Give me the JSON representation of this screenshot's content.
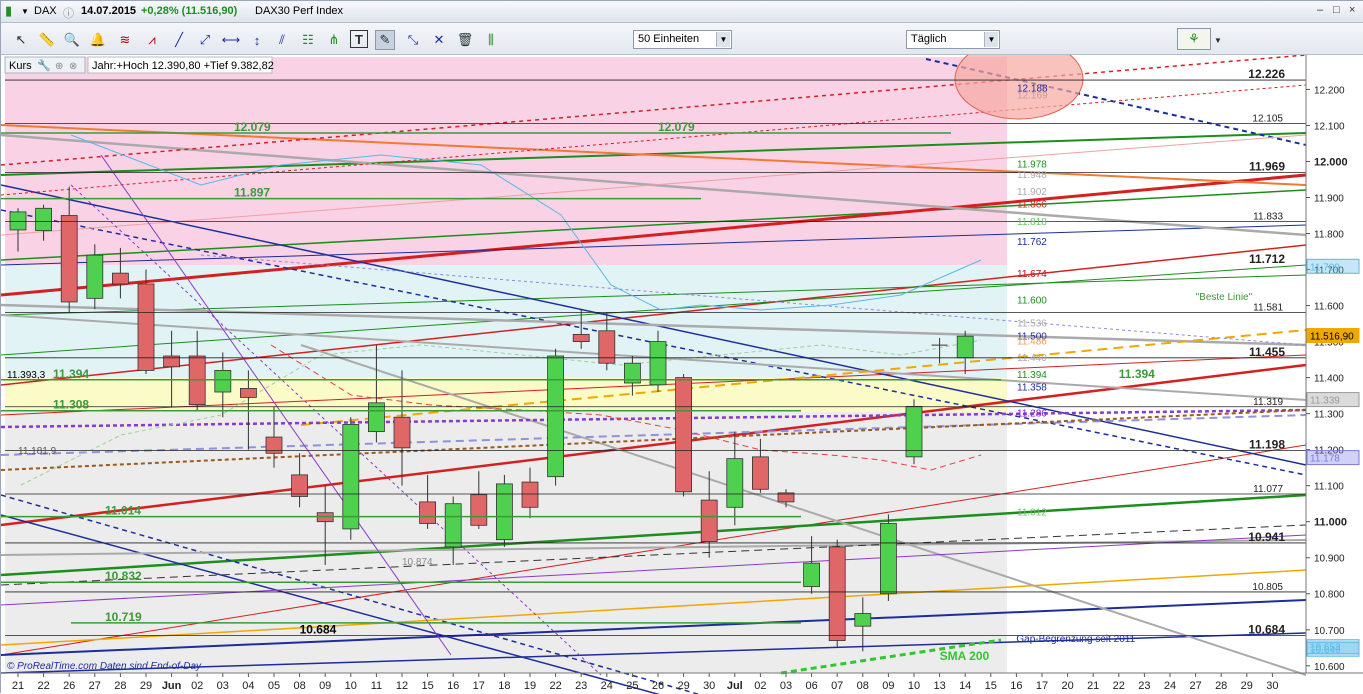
{
  "titlebar": {
    "symbol": "DAX",
    "date": "14.07.2015",
    "change": "+0,28% (11.516,90)",
    "instrument": "DAX30 Perf Index",
    "window_controls": [
      "–",
      "□",
      "×"
    ]
  },
  "toolbar": {
    "units_select": "50 Einheiten",
    "interval_select": "Täglich",
    "tools": [
      "cursor-icon",
      "ruler-icon",
      "zoom-icon",
      "alert-bell-icon",
      "fibonacci-icon",
      "channel-icon",
      "trendline-icon",
      "ray-icon",
      "horizontal-line-icon",
      "vertical-line-icon",
      "parallel-lines-icon",
      "gann-fan-icon",
      "pitchfork-icon",
      "text-icon",
      "drawing-tools-icon",
      "pitchfork-alt-icon",
      "cross-lines-icon",
      "trash-icon",
      "andrews-icon"
    ]
  },
  "chart_header": {
    "label": "Kurs",
    "range_text": "Jahr:+Hoch 12.390,80 +Tief 9.382,82"
  },
  "chart_data": {
    "type": "candlestick",
    "title": "DAX30 Perf Index",
    "ylim": [
      10580,
      12290
    ],
    "x_tick_labels": [
      "21",
      "22",
      "26",
      "27",
      "28",
      "29",
      "Jun",
      "02",
      "03",
      "04",
      "05",
      "08",
      "09",
      "10",
      "11",
      "12",
      "15",
      "16",
      "17",
      "18",
      "19",
      "22",
      "23",
      "24",
      "25",
      "26",
      "29",
      "30",
      "Jul",
      "02",
      "03",
      "06",
      "07",
      "08",
      "09",
      "10",
      "13",
      "14",
      "15",
      "16",
      "17",
      "20",
      "21",
      "22",
      "23",
      "24",
      "27",
      "28",
      "29",
      "30"
    ],
    "y_ticks": [
      10600,
      10700,
      10800,
      10900,
      11000,
      11100,
      11200,
      11300,
      11400,
      11500,
      11600,
      11700,
      11800,
      11900,
      12000,
      12100,
      12200
    ],
    "y_tick_labels": [
      "10.600",
      "10.700",
      "10.800",
      "10.900",
      "11.000",
      "11.100",
      "11.200",
      "11.300",
      "11.400",
      "11.500",
      "11.600",
      "11.700",
      "11.800",
      "11.900",
      "12.000",
      "12.100",
      "12.200"
    ],
    "candles": [
      {
        "date": "21",
        "open": 11810,
        "high": 11870,
        "low": 11750,
        "close": 11860
      },
      {
        "date": "22",
        "open": 11808,
        "high": 11880,
        "low": 11780,
        "close": 11870
      },
      {
        "date": "26",
        "open": 11850,
        "high": 11930,
        "low": 11580,
        "close": 11610
      },
      {
        "date": "27",
        "open": 11620,
        "high": 11770,
        "low": 11590,
        "close": 11740
      },
      {
        "date": "28",
        "open": 11690,
        "high": 11760,
        "low": 11620,
        "close": 11660
      },
      {
        "date": "29",
        "open": 11660,
        "high": 11700,
        "low": 11410,
        "close": 11420
      },
      {
        "date": "Jun",
        "open": 11460,
        "high": 11530,
        "low": 11320,
        "close": 11430
      },
      {
        "date": "02",
        "open": 11460,
        "high": 11530,
        "low": 11310,
        "close": 11325
      },
      {
        "date": "03",
        "open": 11360,
        "high": 11470,
        "low": 11290,
        "close": 11420
      },
      {
        "date": "04",
        "open": 11370,
        "high": 11420,
        "low": 11200,
        "close": 11345
      },
      {
        "date": "05",
        "open": 11235,
        "high": 11320,
        "low": 11150,
        "close": 11190
      },
      {
        "date": "08",
        "open": 11130,
        "high": 11190,
        "low": 11040,
        "close": 11070
      },
      {
        "date": "09",
        "open": 11025,
        "high": 11100,
        "low": 10880,
        "close": 11000
      },
      {
        "date": "10",
        "open": 10980,
        "high": 11290,
        "low": 10950,
        "close": 11270
      },
      {
        "date": "11",
        "open": 11250,
        "high": 11490,
        "low": 11220,
        "close": 11330
      },
      {
        "date": "12",
        "open": 11290,
        "high": 11420,
        "low": 11100,
        "close": 11205
      },
      {
        "date": "15",
        "open": 11055,
        "high": 11130,
        "low": 10980,
        "close": 10995
      },
      {
        "date": "16",
        "open": 10930,
        "high": 11070,
        "low": 10880,
        "close": 11050
      },
      {
        "date": "17",
        "open": 11075,
        "high": 11140,
        "low": 10980,
        "close": 10990
      },
      {
        "date": "18",
        "open": 10950,
        "high": 11130,
        "low": 10930,
        "close": 11105
      },
      {
        "date": "19",
        "open": 11110,
        "high": 11150,
        "low": 11010,
        "close": 11040
      },
      {
        "date": "22",
        "open": 11125,
        "high": 11480,
        "low": 11100,
        "close": 11460
      },
      {
        "date": "23",
        "open": 11520,
        "high": 11590,
        "low": 11480,
        "close": 11500
      },
      {
        "date": "24",
        "open": 11530,
        "high": 11580,
        "low": 11420,
        "close": 11440
      },
      {
        "date": "25",
        "open": 11385,
        "high": 11460,
        "low": 11350,
        "close": 11440
      },
      {
        "date": "26",
        "open": 11380,
        "high": 11530,
        "low": 11360,
        "close": 11500
      },
      {
        "date": "29",
        "open": 11400,
        "high": 11410,
        "low": 11070,
        "close": 11083
      },
      {
        "date": "30",
        "open": 11060,
        "high": 11140,
        "low": 10900,
        "close": 10945
      },
      {
        "date": "Jul",
        "open": 11040,
        "high": 11250,
        "low": 10990,
        "close": 11175
      },
      {
        "date": "02",
        "open": 11180,
        "high": 11230,
        "low": 11080,
        "close": 11090
      },
      {
        "date": "03",
        "open": 11080,
        "high": 11090,
        "low": 11040,
        "close": 11055
      },
      {
        "date": "06",
        "open": 10820,
        "high": 10960,
        "low": 10800,
        "close": 10885
      },
      {
        "date": "07",
        "open": 10930,
        "high": 10950,
        "low": 10650,
        "close": 10670
      },
      {
        "date": "08",
        "open": 10710,
        "high": 10790,
        "low": 10640,
        "close": 10745
      },
      {
        "date": "09",
        "open": 10800,
        "high": 11020,
        "low": 10780,
        "close": 10995
      },
      {
        "date": "10",
        "open": 11180,
        "high": 11340,
        "low": 11160,
        "close": 11320
      },
      {
        "date": "13",
        "open": 11480,
        "high": 11510,
        "low": 11440,
        "close": 11490
      },
      {
        "date": "14",
        "open": 11455,
        "high": 11530,
        "low": 11410,
        "close": 11515
      }
    ],
    "levels_right_axis": [
      {
        "value": 12226,
        "label": "12.226",
        "bold": true
      },
      {
        "value": 12188,
        "label": "12.188",
        "color": "#1c2d9c"
      },
      {
        "value": 12169,
        "label": "12.169",
        "color": "#c89a9a"
      },
      {
        "value": 12105,
        "label": "12.105"
      },
      {
        "value": 11978,
        "label": "11.978",
        "color": "#1d8f1d"
      },
      {
        "value": 11969,
        "label": "11.969",
        "bold": true
      },
      {
        "value": 11948,
        "label": "11.948",
        "color": "#aaaaaa"
      },
      {
        "value": 11902,
        "label": "11.902",
        "color": "#aaaaaa"
      },
      {
        "value": 11866,
        "label": "11.866",
        "color": "#d42020"
      },
      {
        "value": 11833,
        "label": "11.833"
      },
      {
        "value": 11818,
        "label": "11.818",
        "color": "#6ac46a"
      },
      {
        "value": 11762,
        "label": "11.762",
        "color": "#1c2d9c"
      },
      {
        "value": 11712,
        "label": "11.712",
        "bold": true
      },
      {
        "value": 11674,
        "label": "11.674",
        "color": "#888888"
      },
      {
        "value": 11674,
        "label": "11.674",
        "color": "#d42020"
      },
      {
        "value": 11600,
        "label": "11.600",
        "color": "#1d8f1d"
      },
      {
        "value": 11581,
        "label": "11.581"
      },
      {
        "value": 11536,
        "label": "11.536",
        "color": "#aaaaaa"
      },
      {
        "value": 11500,
        "label": "11.500",
        "color": "#1c2d9c"
      },
      {
        "value": 11486,
        "label": "11.486",
        "color": "#e8a060"
      },
      {
        "value": 11455,
        "label": "11.455",
        "bold": true
      },
      {
        "value": 11440,
        "label": "11.440",
        "color": "#aaaaaa"
      },
      {
        "value": 11394,
        "label": "11.394",
        "color": "#1d8f1d"
      },
      {
        "value": 11358,
        "label": "11.358",
        "color": "#1c2d9c"
      },
      {
        "value": 11319,
        "label": "11.319"
      },
      {
        "value": 11286,
        "label": "11.286",
        "color": "#7a20c8"
      },
      {
        "value": 11198,
        "label": "11.198",
        "bold": true
      },
      {
        "value": 11077,
        "label": "11.077"
      },
      {
        "value": 11012,
        "label": "11.012",
        "color": "#6ac46a"
      },
      {
        "value": 10941,
        "label": "10.941",
        "bold": true
      },
      {
        "value": 10805,
        "label": "10.805"
      },
      {
        "value": 10684,
        "label": "10.684",
        "bold": true
      }
    ],
    "axis_badges": [
      {
        "value": 11709,
        "label": "11.709",
        "color": "#5ab8e6"
      },
      {
        "value": 11516.9,
        "label": "11.516,90",
        "color": "#f0a800"
      },
      {
        "value": 11339,
        "label": "11.339",
        "color": "#999999"
      },
      {
        "value": 11178,
        "label": "11.178",
        "color": "#7a7ae0"
      },
      {
        "value": 10653,
        "label": "10.653",
        "color": "#5ab8e6"
      },
      {
        "value": 10646,
        "label": "10.646",
        "color": "#5ab8e6"
      }
    ],
    "left_level_labels": [
      {
        "value": 12079,
        "label": "12.079",
        "color": "#3a9a3a"
      },
      {
        "value": 11897,
        "label": "11.897",
        "color": "#3a9a3a"
      },
      {
        "value": 11394,
        "label": "11.394",
        "color": "#3a9a3a"
      },
      {
        "value": 11393.3,
        "label": "11.393,3",
        "color": "#000000"
      },
      {
        "value": 11308,
        "label": "11.308",
        "color": "#3a9a3a"
      },
      {
        "value": 11014,
        "label": "11.014",
        "color": "#3a9a3a"
      },
      {
        "value": 10832,
        "label": "10.832",
        "color": "#3a9a3a"
      },
      {
        "value": 10719,
        "label": "10.719",
        "color": "#3a9a3a"
      }
    ],
    "annotations": [
      {
        "text": "12.079",
        "date_index": 25,
        "value": 12079,
        "color": "#3a9a3a"
      },
      {
        "text": "10.684",
        "date_index": 11,
        "value": 10684,
        "color": "#000000"
      },
      {
        "text": "11.394",
        "date_index": 43,
        "value": 11394,
        "color": "#3a9a3a"
      },
      {
        "text": "\"Beste Linie\"",
        "date_index": 46,
        "value": 11610,
        "color": "#3a9a3a"
      },
      {
        "text": "Gap-Begrenzung seit 2011",
        "date_index": 39,
        "value": 10660,
        "color": "#1c2d9c"
      },
      {
        "text": "SMA 200",
        "date_index": 36,
        "value": 10610,
        "color": "#2ec82e"
      },
      {
        "text": "10.874",
        "date_index": 15,
        "value": 10874,
        "color": "#888888"
      },
      {
        "text": "11.181,9",
        "date_index": 0,
        "value": 11182,
        "color": "#555555"
      }
    ],
    "zones": [
      {
        "from": 11712,
        "to": 12290,
        "color": "#fad2e6"
      },
      {
        "from": 11330,
        "to": 11712,
        "color": "#e2f3f5"
      },
      {
        "from": 11305,
        "to": 11400,
        "color": "#fbfbc8"
      },
      {
        "from": 10580,
        "to": 11305,
        "color": "#ececec"
      }
    ],
    "footer_left": "© ProRealTime.com  Daten sind End-of-Day"
  }
}
